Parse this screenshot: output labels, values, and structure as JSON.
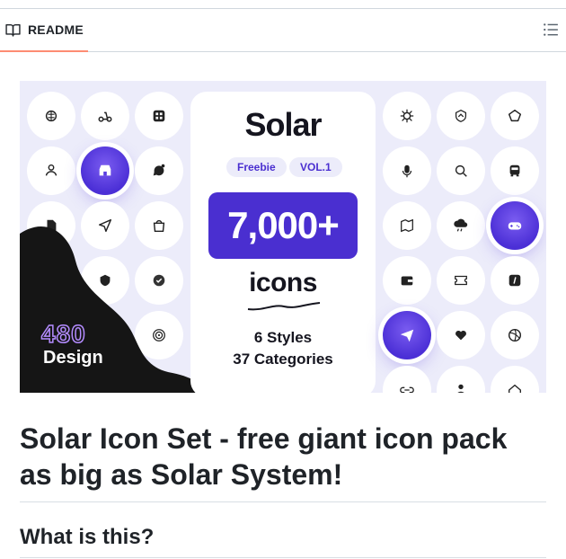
{
  "readme_tab": {
    "label": "README",
    "icon": "book-icon"
  },
  "toc_button": {
    "icon": "list-icon"
  },
  "hero": {
    "brand": "Solar",
    "pills": [
      "Freebie",
      "VOL.1"
    ],
    "count": "7,000+",
    "noun": "icons",
    "styles": "6 Styles",
    "categories": "37 Categories",
    "badge_number": "480",
    "badge_word": "Design",
    "accent_color": "#4a2fd0",
    "background_color": "#ececfa"
  },
  "heading": "Solar Icon Set - free giant icon pack as big as Solar System!",
  "subheading": "What is this?"
}
